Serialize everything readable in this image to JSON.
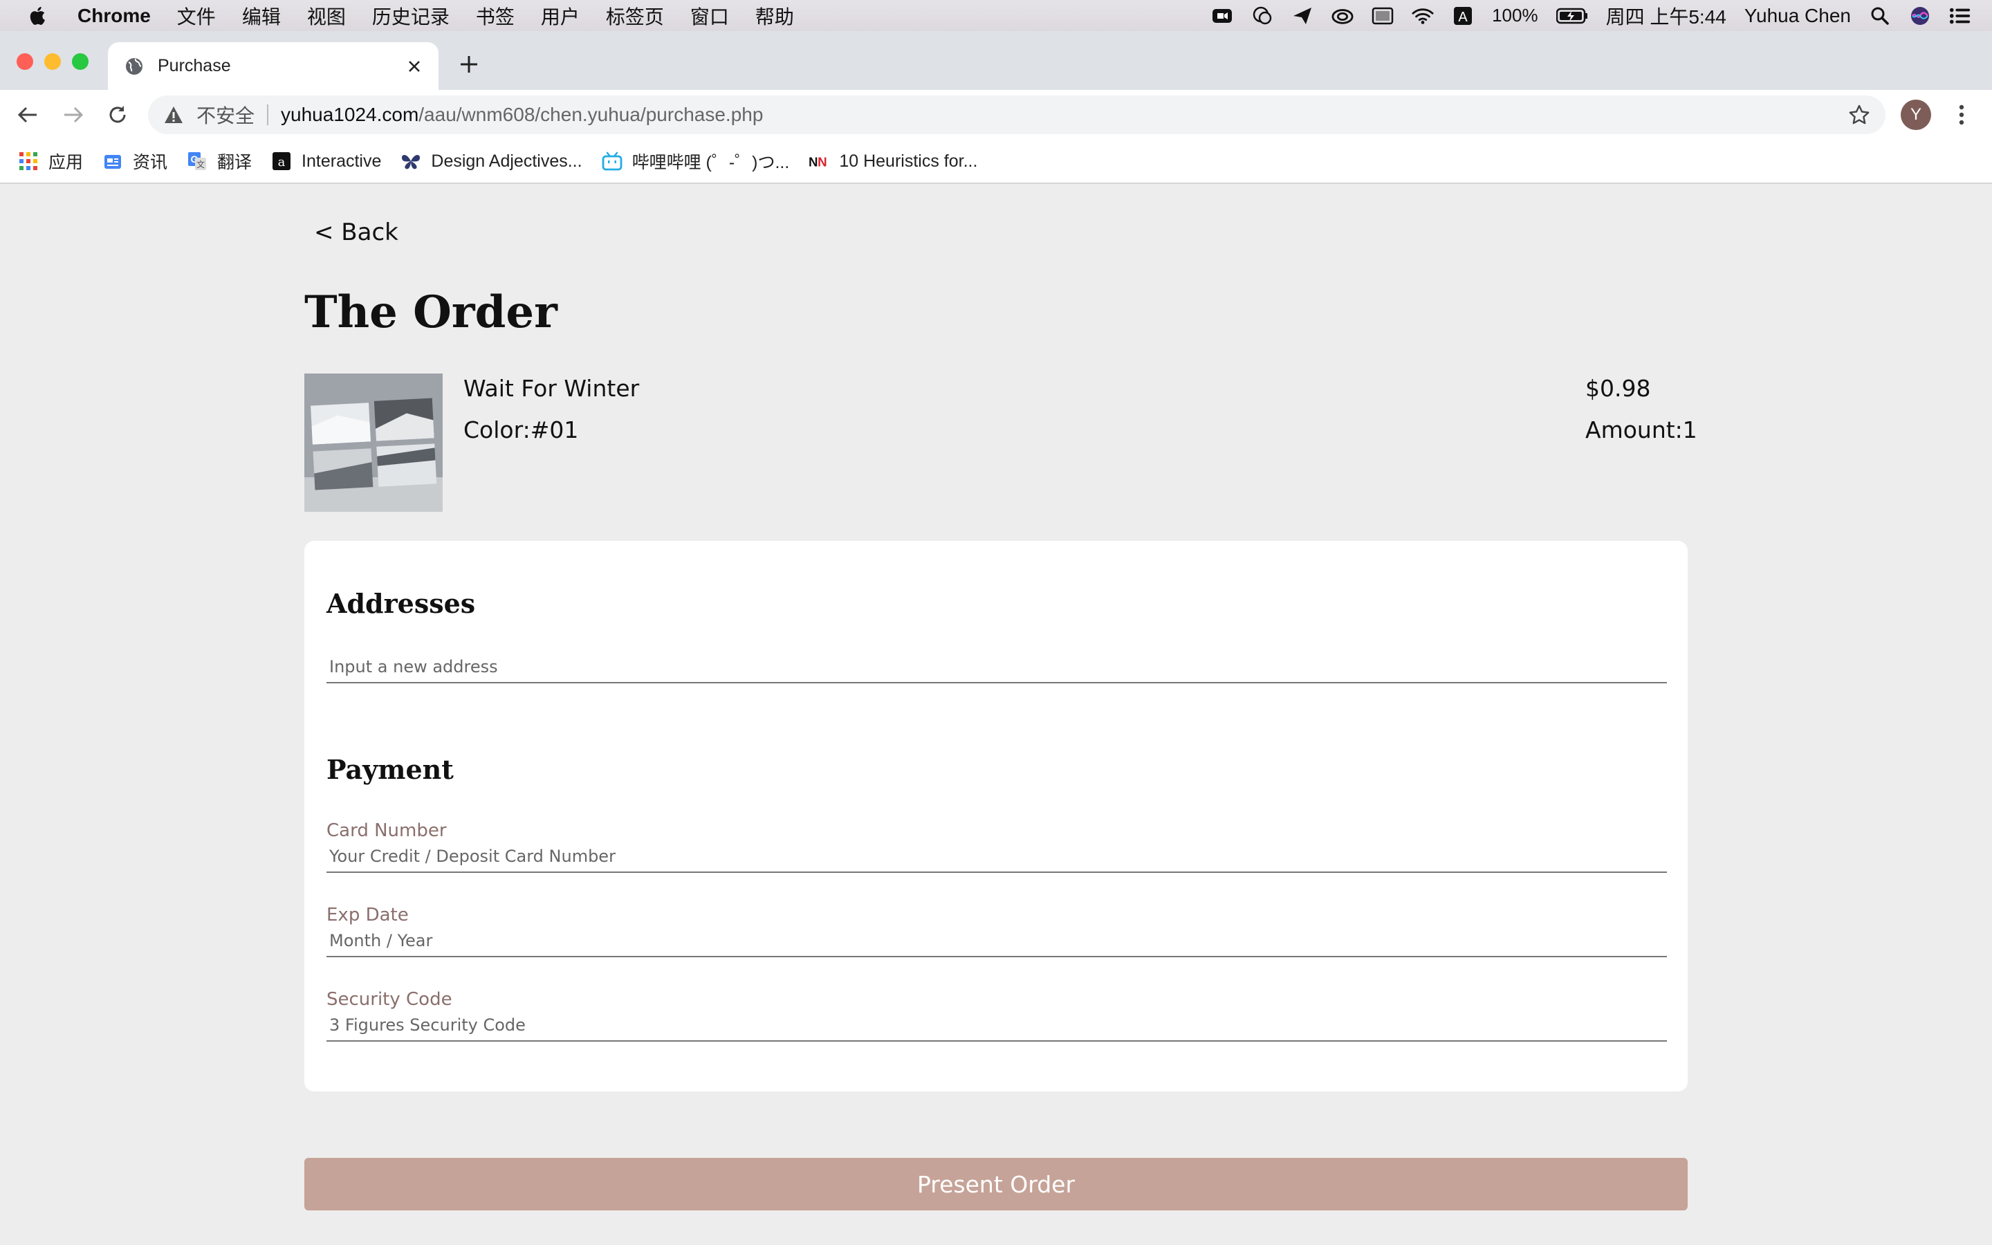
{
  "menubar": {
    "app_name": "Chrome",
    "items": [
      "文件",
      "编辑",
      "视图",
      "历史记录",
      "书签",
      "用户",
      "标签页",
      "窗口",
      "帮助"
    ],
    "battery": "100%",
    "datetime": "周四 上午5:44",
    "user": "Yuhua Chen"
  },
  "tab": {
    "title": "Purchase"
  },
  "toolbar": {
    "security_label": "不安全",
    "url_host": "yuhua1024.com",
    "url_path": "/aau/wnm608/chen.yuhua/purchase.php",
    "avatar_letter": "Y"
  },
  "bookmarks": [
    {
      "label": "应用",
      "icon": "apps-grid-icon"
    },
    {
      "label": "资讯",
      "icon": "news-icon"
    },
    {
      "label": "翻译",
      "icon": "google-translate-icon"
    },
    {
      "label": "Interactive",
      "icon": "interactive-icon"
    },
    {
      "label": "Design Adjectives...",
      "icon": "butterfly-icon"
    },
    {
      "label": "哔哩哔哩 (゜-゜)つ...",
      "icon": "bilibili-icon"
    },
    {
      "label": "10 Heuristics for...",
      "icon": "nn-icon"
    }
  ],
  "page": {
    "back_label": "< Back",
    "title": "The Order",
    "product": {
      "name": "Wait For Winter",
      "color": "Color:#01",
      "price": "$0.98",
      "amount": "Amount:1"
    },
    "addresses": {
      "title": "Addresses",
      "placeholder": "Input a new address"
    },
    "payment": {
      "title": "Payment",
      "card_label": "Card Number",
      "card_placeholder": "Your Credit / Deposit Card Number",
      "exp_label": "Exp Date",
      "exp_placeholder": "Month / Year",
      "code_label": "Security Code",
      "code_placeholder": "3 Figures Security Code"
    },
    "submit_label": "Present Order"
  },
  "colors": {
    "accent": "#c6a398",
    "label": "#8a6f6c",
    "page_bg": "#eeedee"
  }
}
